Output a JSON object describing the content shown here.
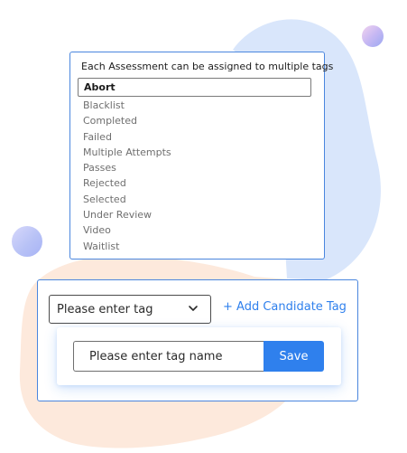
{
  "colors": {
    "accent": "#2f80ed",
    "card_border": "#4a86de",
    "blob_blue": "#d9e6fb",
    "blob_peach": "#fde9dc"
  },
  "tags_panel": {
    "title": "Each Assessment can be assigned to multiple tags",
    "selected": "Abort",
    "items": [
      {
        "label": "Abort"
      },
      {
        "label": "Blacklist"
      },
      {
        "label": "Completed"
      },
      {
        "label": "Failed"
      },
      {
        "label": "Multiple Attempts"
      },
      {
        "label": "Passes"
      },
      {
        "label": "Rejected"
      },
      {
        "label": "Selected"
      },
      {
        "label": "Under Review"
      },
      {
        "label": "Video"
      },
      {
        "label": "Waitlist"
      }
    ]
  },
  "candidate_tag": {
    "select_value": "Please enter tag",
    "select_icon": "chevron-down-icon",
    "add_link": "+ Add Candidate Tag",
    "input_placeholder": "Please enter tag name",
    "save_label": "Save"
  }
}
